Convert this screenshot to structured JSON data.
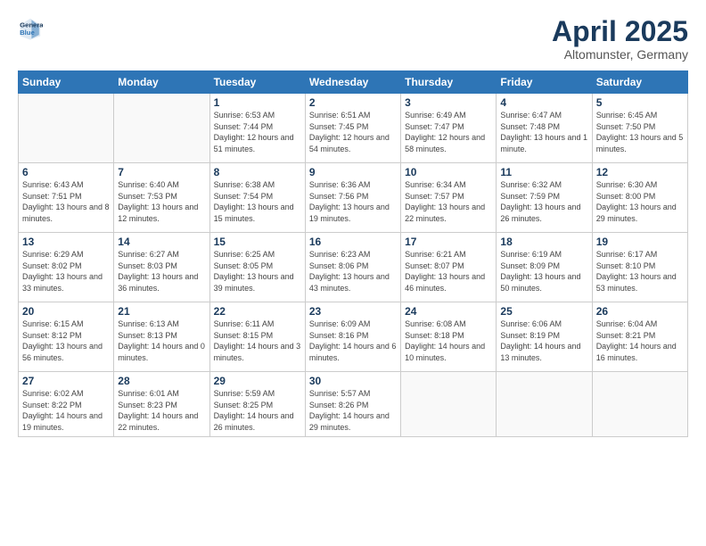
{
  "header": {
    "logo_line1": "General",
    "logo_line2": "Blue",
    "title": "April 2025",
    "subtitle": "Altomunster, Germany"
  },
  "days_of_week": [
    "Sunday",
    "Monday",
    "Tuesday",
    "Wednesday",
    "Thursday",
    "Friday",
    "Saturday"
  ],
  "weeks": [
    [
      {
        "day": "",
        "info": ""
      },
      {
        "day": "",
        "info": ""
      },
      {
        "day": "1",
        "info": "Sunrise: 6:53 AM\nSunset: 7:44 PM\nDaylight: 12 hours and 51 minutes."
      },
      {
        "day": "2",
        "info": "Sunrise: 6:51 AM\nSunset: 7:45 PM\nDaylight: 12 hours and 54 minutes."
      },
      {
        "day": "3",
        "info": "Sunrise: 6:49 AM\nSunset: 7:47 PM\nDaylight: 12 hours and 58 minutes."
      },
      {
        "day": "4",
        "info": "Sunrise: 6:47 AM\nSunset: 7:48 PM\nDaylight: 13 hours and 1 minute."
      },
      {
        "day": "5",
        "info": "Sunrise: 6:45 AM\nSunset: 7:50 PM\nDaylight: 13 hours and 5 minutes."
      }
    ],
    [
      {
        "day": "6",
        "info": "Sunrise: 6:43 AM\nSunset: 7:51 PM\nDaylight: 13 hours and 8 minutes."
      },
      {
        "day": "7",
        "info": "Sunrise: 6:40 AM\nSunset: 7:53 PM\nDaylight: 13 hours and 12 minutes."
      },
      {
        "day": "8",
        "info": "Sunrise: 6:38 AM\nSunset: 7:54 PM\nDaylight: 13 hours and 15 minutes."
      },
      {
        "day": "9",
        "info": "Sunrise: 6:36 AM\nSunset: 7:56 PM\nDaylight: 13 hours and 19 minutes."
      },
      {
        "day": "10",
        "info": "Sunrise: 6:34 AM\nSunset: 7:57 PM\nDaylight: 13 hours and 22 minutes."
      },
      {
        "day": "11",
        "info": "Sunrise: 6:32 AM\nSunset: 7:59 PM\nDaylight: 13 hours and 26 minutes."
      },
      {
        "day": "12",
        "info": "Sunrise: 6:30 AM\nSunset: 8:00 PM\nDaylight: 13 hours and 29 minutes."
      }
    ],
    [
      {
        "day": "13",
        "info": "Sunrise: 6:29 AM\nSunset: 8:02 PM\nDaylight: 13 hours and 33 minutes."
      },
      {
        "day": "14",
        "info": "Sunrise: 6:27 AM\nSunset: 8:03 PM\nDaylight: 13 hours and 36 minutes."
      },
      {
        "day": "15",
        "info": "Sunrise: 6:25 AM\nSunset: 8:05 PM\nDaylight: 13 hours and 39 minutes."
      },
      {
        "day": "16",
        "info": "Sunrise: 6:23 AM\nSunset: 8:06 PM\nDaylight: 13 hours and 43 minutes."
      },
      {
        "day": "17",
        "info": "Sunrise: 6:21 AM\nSunset: 8:07 PM\nDaylight: 13 hours and 46 minutes."
      },
      {
        "day": "18",
        "info": "Sunrise: 6:19 AM\nSunset: 8:09 PM\nDaylight: 13 hours and 50 minutes."
      },
      {
        "day": "19",
        "info": "Sunrise: 6:17 AM\nSunset: 8:10 PM\nDaylight: 13 hours and 53 minutes."
      }
    ],
    [
      {
        "day": "20",
        "info": "Sunrise: 6:15 AM\nSunset: 8:12 PM\nDaylight: 13 hours and 56 minutes."
      },
      {
        "day": "21",
        "info": "Sunrise: 6:13 AM\nSunset: 8:13 PM\nDaylight: 14 hours and 0 minutes."
      },
      {
        "day": "22",
        "info": "Sunrise: 6:11 AM\nSunset: 8:15 PM\nDaylight: 14 hours and 3 minutes."
      },
      {
        "day": "23",
        "info": "Sunrise: 6:09 AM\nSunset: 8:16 PM\nDaylight: 14 hours and 6 minutes."
      },
      {
        "day": "24",
        "info": "Sunrise: 6:08 AM\nSunset: 8:18 PM\nDaylight: 14 hours and 10 minutes."
      },
      {
        "day": "25",
        "info": "Sunrise: 6:06 AM\nSunset: 8:19 PM\nDaylight: 14 hours and 13 minutes."
      },
      {
        "day": "26",
        "info": "Sunrise: 6:04 AM\nSunset: 8:21 PM\nDaylight: 14 hours and 16 minutes."
      }
    ],
    [
      {
        "day": "27",
        "info": "Sunrise: 6:02 AM\nSunset: 8:22 PM\nDaylight: 14 hours and 19 minutes."
      },
      {
        "day": "28",
        "info": "Sunrise: 6:01 AM\nSunset: 8:23 PM\nDaylight: 14 hours and 22 minutes."
      },
      {
        "day": "29",
        "info": "Sunrise: 5:59 AM\nSunset: 8:25 PM\nDaylight: 14 hours and 26 minutes."
      },
      {
        "day": "30",
        "info": "Sunrise: 5:57 AM\nSunset: 8:26 PM\nDaylight: 14 hours and 29 minutes."
      },
      {
        "day": "",
        "info": ""
      },
      {
        "day": "",
        "info": ""
      },
      {
        "day": "",
        "info": ""
      }
    ]
  ]
}
